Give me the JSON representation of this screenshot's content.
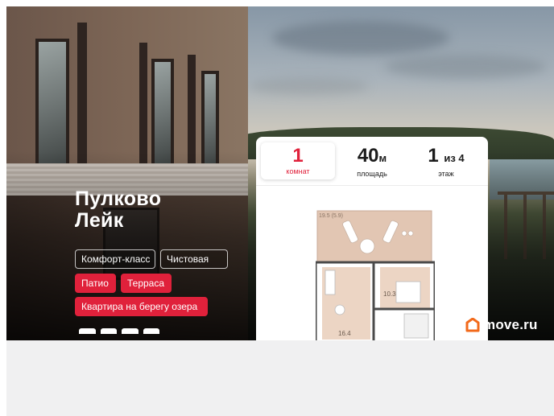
{
  "listing": {
    "title_line1": "Пулково",
    "title_line2": "Лейк",
    "tags": {
      "comfort": "Комфорт-класс",
      "finish": "Чистовая",
      "patio": "Патио",
      "terrace": "Терраса",
      "lake": "Квартира на берегу озера"
    }
  },
  "card": {
    "rooms": {
      "value": "1",
      "label": "комнат"
    },
    "area": {
      "value": "40",
      "unit": "м",
      "label": "площадь"
    },
    "floor": {
      "value": "1",
      "suffix": "из 4",
      "label": "этаж"
    }
  },
  "plan": {
    "terrace_label": "19.5 (5.9)",
    "bedroom_area": "10.3",
    "living_area": "16.4"
  },
  "watermark": {
    "text": "move.ru"
  },
  "colors": {
    "accent": "#e0213b",
    "logo": "#f26a1b"
  }
}
